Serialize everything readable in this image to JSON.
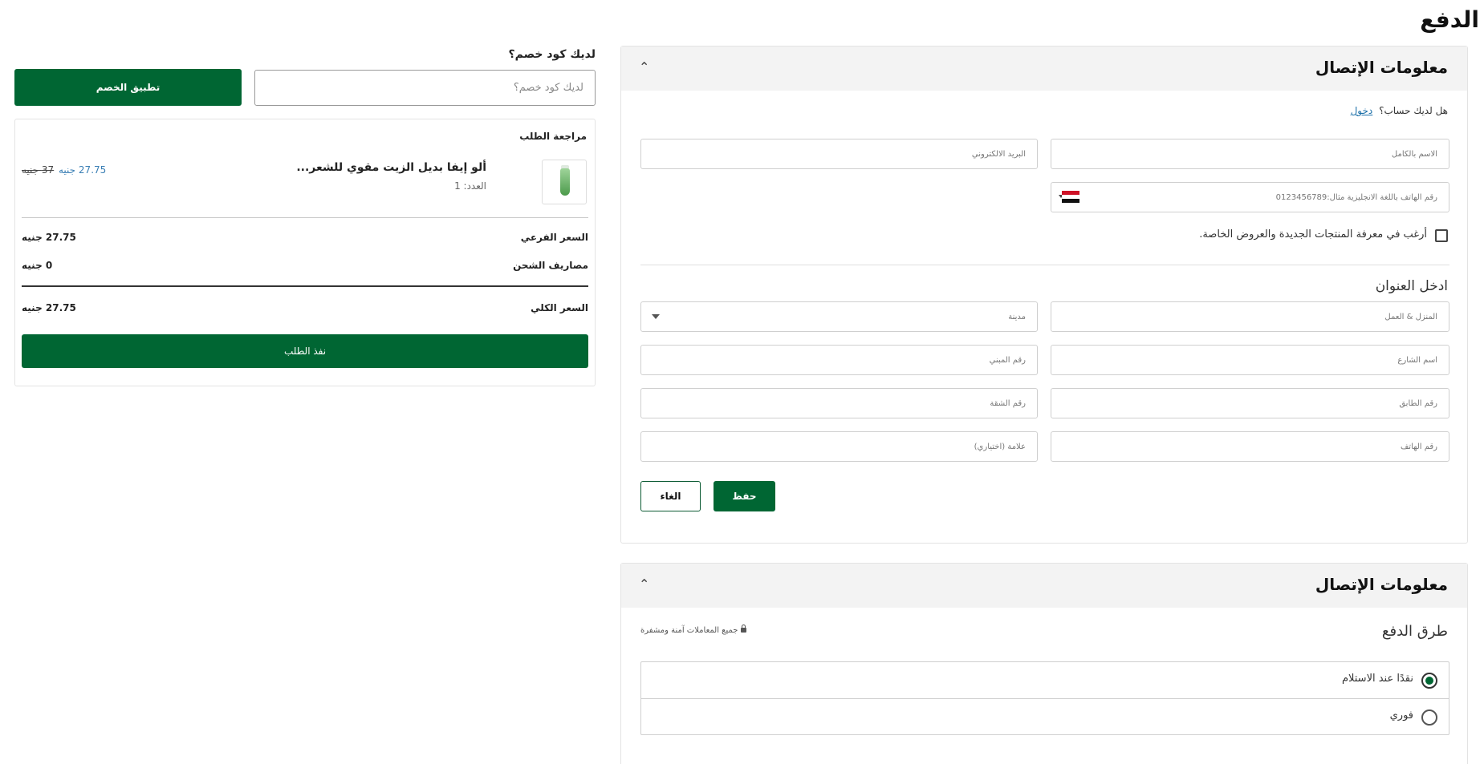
{
  "page": {
    "title": "الدفع"
  },
  "discount": {
    "label": "لديك كود خصم؟",
    "placeholder": "لديك كود خصم؟",
    "apply_label": "تطبيق الخصم"
  },
  "order_review": {
    "title": "مراجعة الطلب",
    "product": {
      "name": "ألو إيفا بديل الزيت مقوي للشعر...",
      "quantity": "العدد: 1",
      "price_new": "27.75 جنيه",
      "price_old": "37 جنيه"
    },
    "subtotal": {
      "label": "السعر الفرعي",
      "value": "27.75 جنيه"
    },
    "shipping": {
      "label": "مصاريف الشحن",
      "value": "0 جنيه"
    },
    "total": {
      "label": "السعر الكلي",
      "value": "27.75 جنيه"
    },
    "checkout_label": "نفذ الطلب"
  },
  "contact_panel": {
    "title": "معلومات الإتصال",
    "chevron": "chevron-up-icon",
    "login_prompt": "هل لديك حساب؟",
    "login_link": "دخول",
    "fields": {
      "full_name": "الاسم بالكامل",
      "email": "البريد الالكتروني",
      "phone": "رقم الهاتف باللغة الانجليزية مثال:0123456789"
    },
    "newsletter_label": "أرغب في معرفة المنتجات الجديدة والعروض الخاصة.",
    "address_title": "ادخل العنوان",
    "address_fields": {
      "home_work": "المنزل & العمل",
      "city": "مدينة",
      "street": "اسم الشارع",
      "building": "رقم المبني",
      "floor": "رقم الطابق",
      "apartment": "رقم الشقة",
      "phone": "رقم الهاتف",
      "landmark": "علامة (اختياري)"
    },
    "save_label": "حفظ",
    "cancel_label": "الغاء"
  },
  "payment_panel": {
    "title": "معلومات الإتصال",
    "chevron": "chevron-up-icon",
    "methods_title": "طرق الدفع",
    "secure_note": "جميع المعاملات آمنة ومشفرة",
    "options": [
      {
        "label": "نقدًا عند الاستلام",
        "selected": true
      },
      {
        "label": "فوري",
        "selected": false
      }
    ]
  },
  "colors": {
    "brand_green": "#006633",
    "link_blue": "#1b6fa8"
  }
}
